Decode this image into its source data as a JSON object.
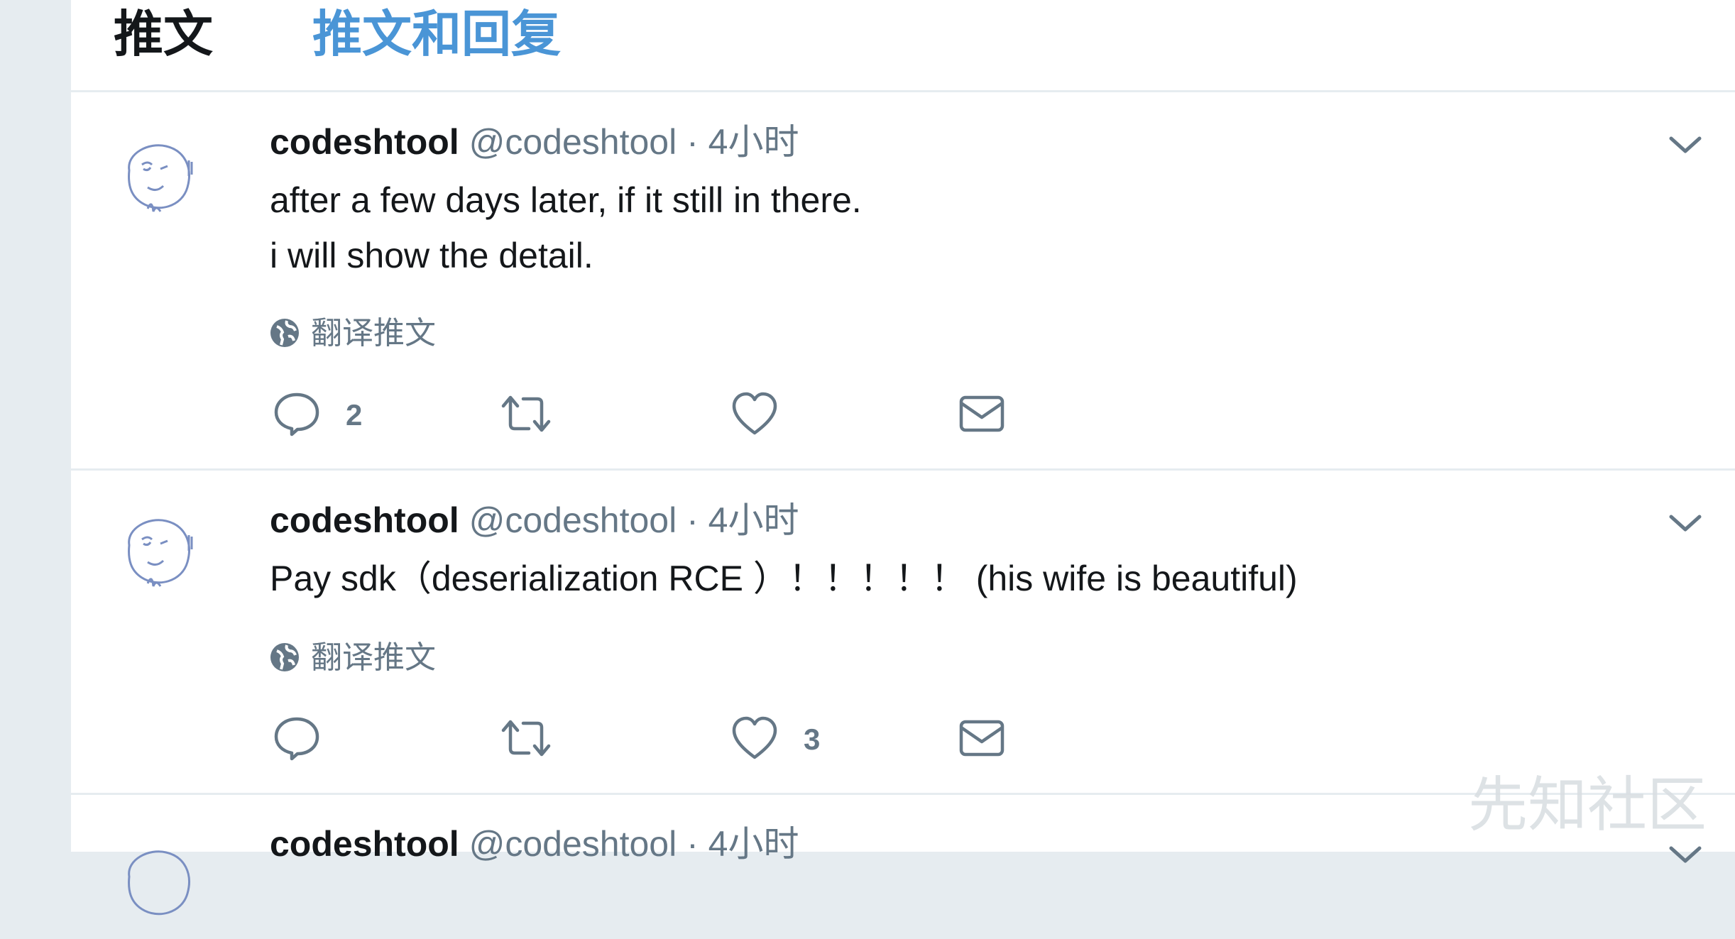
{
  "tabs": {
    "tweets": "推文",
    "tweets_replies": "推文和回复"
  },
  "tweets": [
    {
      "name": "codeshtool",
      "handle": "@codeshtool",
      "separator": "·",
      "time": "4小时",
      "lines": [
        "after  a few days later, if it still in there.",
        "i will show the detail."
      ],
      "translate_label": "翻译推文",
      "reply_count": "2",
      "like_count": ""
    },
    {
      "name": "codeshtool",
      "handle": "@codeshtool",
      "separator": "·",
      "time": "4小时",
      "lines": [
        "Pay sdk（deserialization   RCE  ）！！！！！ (his wife is beautiful)"
      ],
      "translate_label": "翻译推文",
      "reply_count": "",
      "like_count": "3"
    },
    {
      "name": "codeshtool",
      "handle": "@codeshtool",
      "separator": "·",
      "time": "4小时"
    }
  ],
  "watermark": "先知社区",
  "icons": {
    "reply": "reply-icon",
    "retweet": "retweet-icon",
    "like": "heart-icon",
    "dm": "envelope-icon",
    "translate": "globe-icon",
    "caret": "chevron-down-icon"
  },
  "colors": {
    "accent": "#4a95d6",
    "muted": "#657786",
    "border": "#e6ecf0"
  }
}
